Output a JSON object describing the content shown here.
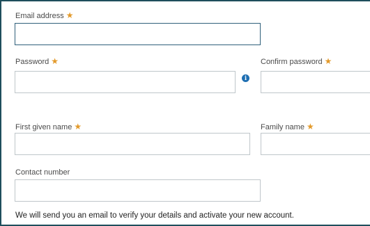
{
  "form": {
    "email": {
      "label": "Email address",
      "required_mark": "★",
      "value": ""
    },
    "password": {
      "label": "Password",
      "required_mark": "★",
      "value": "",
      "info_icon": "info-icon",
      "info_glyph": "i"
    },
    "confirm_password": {
      "label": "Confirm password",
      "required_mark": "★",
      "value": ""
    },
    "first_name": {
      "label": "First given name",
      "required_mark": "★",
      "value": ""
    },
    "family_name": {
      "label": "Family name",
      "required_mark": "★",
      "value": ""
    },
    "contact_number": {
      "label": "Contact number",
      "value": ""
    },
    "verification_note": "We will send you an email to verify your details and activate your new account."
  },
  "colors": {
    "required": "#e39a2b",
    "focus_border": "#2f5f7a",
    "info_icon": "#1f6fb2"
  }
}
